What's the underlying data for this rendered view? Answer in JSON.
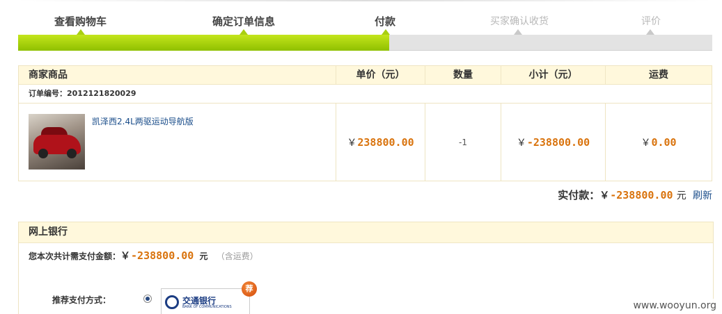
{
  "steps": [
    {
      "label": "查看购物车",
      "state": "done"
    },
    {
      "label": "确定订单信息",
      "state": "done"
    },
    {
      "label": "付款",
      "state": "current"
    },
    {
      "label": "买家确认收货",
      "state": "todo"
    },
    {
      "label": "评价",
      "state": "todo"
    }
  ],
  "progress_fraction": 0.535,
  "colors": {
    "progress_fill": "#a9cf12",
    "price": "#d9730d",
    "link": "#1a4d8a",
    "header_bg": "#fff8dc"
  },
  "order": {
    "headers": {
      "product": "商家商品",
      "unit_price": "单价（元）",
      "qty": "数量",
      "subtotal": "小计（元）",
      "shipping": "运费"
    },
    "order_no": "订单编号：2012121820029",
    "item": {
      "image_icon": "car-thumbnail",
      "name": "凯泽西2.4L两驱运动导航版",
      "currency": "￥",
      "unit_price": "238800.00",
      "qty": "-1",
      "subtotal": "-238800.00",
      "shipping": "0.00"
    }
  },
  "paid": {
    "label": "实付款：",
    "currency": "￥",
    "amount": "-238800.00",
    "unit": "元",
    "refresh": "刷新"
  },
  "bank": {
    "title": "网上银行",
    "total_label": "您本次共计需支付金额：",
    "currency": "￥",
    "amount": "-238800.00",
    "unit": "元",
    "note": "（含运费）",
    "recommend_label": "推荐支付方式：",
    "bank_name": "交通银行",
    "bank_name_en": "BANK OF COMMUNICATIONS",
    "badge": "荐"
  },
  "watermark": "www.wooyun.org"
}
